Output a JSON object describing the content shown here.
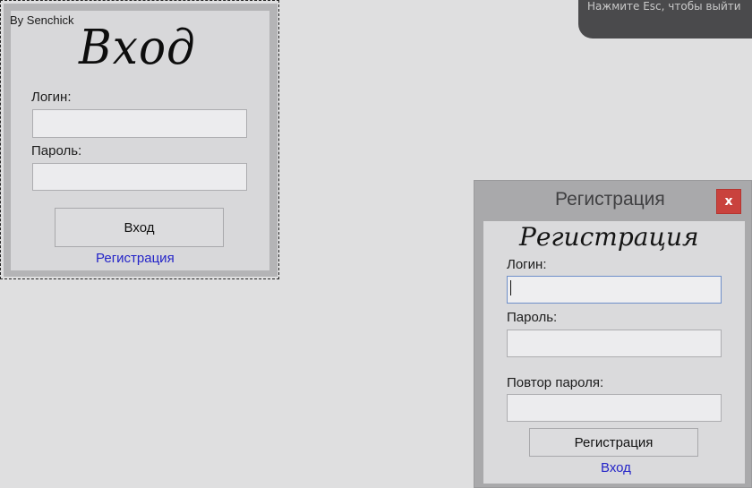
{
  "toast": {
    "text": "Нажмите Esc, чтобы выйти"
  },
  "login_form": {
    "author": "By Senchick",
    "title": "Вход",
    "login_label": "Логин:",
    "login_value": "",
    "password_label": "Пароль:",
    "password_value": "",
    "submit_label": "Вход",
    "register_link": "Регистрация"
  },
  "register_window": {
    "window_title": "Регистрация",
    "close_glyph": "x",
    "title": "Регистрация",
    "login_label": "Логин:",
    "login_value": "",
    "password_label": "Пароль:",
    "password_value": "",
    "repeat_label": "Повтор пароля:",
    "repeat_value": "",
    "submit_label": "Регистрация",
    "login_link": "Вход"
  },
  "colors": {
    "window_bg": "#a9a9ab",
    "panel_bg": "#dadadc",
    "link": "#2424c8",
    "close_button": "#c9423d"
  }
}
